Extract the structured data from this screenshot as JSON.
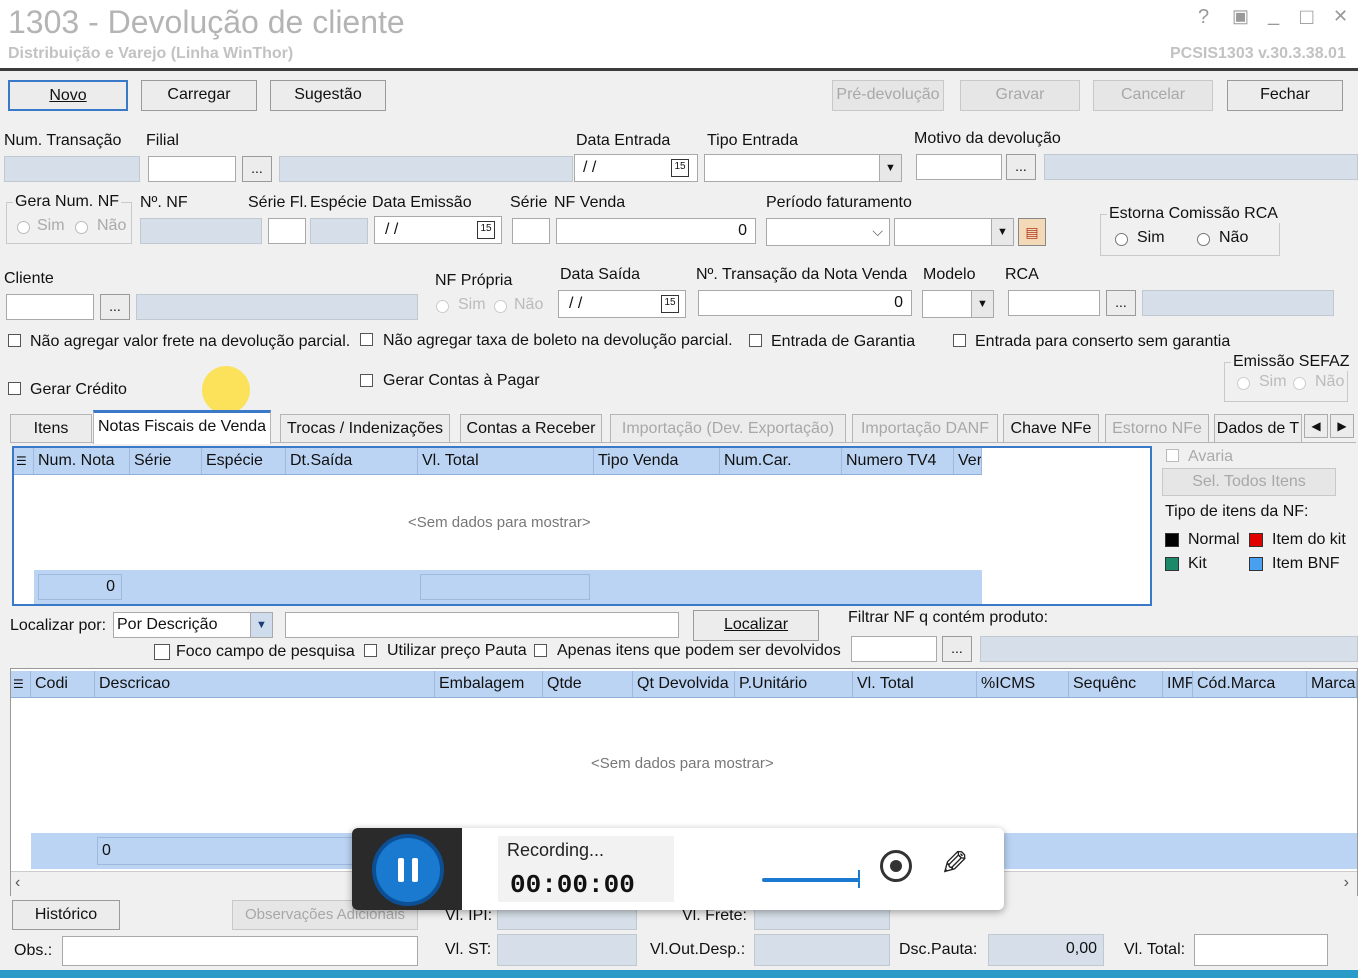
{
  "window": {
    "title": "1303 - Devolução de cliente",
    "subtitle": "Distribuição e Varejo (Linha WinThor)",
    "version": "PCSIS1303  v.30.3.38.01",
    "controls": [
      "?",
      "▣",
      "_",
      "□",
      "✕"
    ]
  },
  "toolbar": {
    "novo": "Novo",
    "carregar": "Carregar",
    "sugestao": "Sugestão",
    "pre_devolucao": "Pré-devolução",
    "gravar": "Gravar",
    "cancelar": "Cancelar",
    "fechar": "Fechar"
  },
  "form": {
    "num_transacao": "Num. Transação",
    "filial": "Filial",
    "data_entrada": "Data Entrada",
    "data_entrada_value": "/ /",
    "tipo_entrada": "Tipo Entrada",
    "motivo": "Motivo da devolução",
    "gera_num_nf": "Gera Num. NF",
    "sim": "Sim",
    "nao": "Não",
    "no_nf": "Nº. NF",
    "serie_fl": "Série Fl.",
    "especie": "Espécie",
    "data_emissao": "Data Emissão",
    "data_emissao_value": "/ /",
    "serie": "Série",
    "nf_venda": "NF Venda",
    "nf_venda_value": "0",
    "periodo_faturamento": "Período faturamento",
    "estorna_comissao": "Estorna Comissão RCA",
    "cliente": "Cliente",
    "nf_propria": "NF Própria",
    "data_saida": "Data Saída",
    "data_saida_value": "/ /",
    "no_transacao_nota_venda": "Nº. Transação da Nota Venda",
    "no_transacao_value": "0",
    "modelo": "Modelo",
    "rca": "RCA",
    "cb_frete": "Não agregar valor frete na devolução parcial.",
    "cb_boleto": "Não agregar taxa de boleto na devolução parcial.",
    "cb_garantia": "Entrada de Garantia",
    "cb_conserto": "Entrada para conserto sem garantia",
    "cb_credito": "Gerar Crédito",
    "cb_contas_pagar": "Gerar Contas à Pagar",
    "emissao_sefaz": "Emissão SEFAZ"
  },
  "tabs": [
    {
      "label": "Itens"
    },
    {
      "label": "Notas Fiscais de Venda"
    },
    {
      "label": "Trocas / Indenizações"
    },
    {
      "label": "Contas a Receber"
    },
    {
      "label": "Importação (Dev. Exportação)"
    },
    {
      "label": "Importação DANF"
    },
    {
      "label": "Chave NFe"
    },
    {
      "label": "Estorno NFe"
    },
    {
      "label": "Dados de T"
    }
  ],
  "nf_grid": {
    "columns": [
      "Num. Nota",
      "Série",
      "Espécie",
      "Dt.Saída",
      "Vl. Total",
      "Tipo Venda",
      "Num.Car.",
      "Numero TV4",
      "Ver"
    ],
    "empty": "<Sem dados para mostrar>",
    "footer_count": "0"
  },
  "side": {
    "avaria": "Avaria",
    "sel_todos": "Sel. Todos Itens",
    "tipo_itens": "Tipo de itens da NF:",
    "legend": [
      {
        "label": "Normal",
        "color": "#000000"
      },
      {
        "label": "Item do kit",
        "color": "#e00000"
      },
      {
        "label": "Kit",
        "color": "#1a8a6a"
      },
      {
        "label": "Item BNF",
        "color": "#4aa0f0"
      }
    ]
  },
  "search": {
    "localizar_por": "Localizar por:",
    "option": "Por Descrição",
    "localizar_btn": "Localizar",
    "filtrar": "Filtrar NF q contém produto:",
    "foco": "Foco campo de pesquisa",
    "preco_pauta": "Utilizar preço Pauta",
    "apenas": "Apenas itens que podem ser devolvidos"
  },
  "items_grid": {
    "columns": [
      "Codi",
      "Descricao",
      "Embalagem",
      "Qtde",
      "Qt Devolvida",
      "P.Unitário",
      "Vl. Total",
      "%ICMS",
      "Sequênc",
      "IMF",
      "Cód.Marca",
      "Marca"
    ],
    "empty": "<Sem dados para mostrar>",
    "footer_count": "0"
  },
  "bottom": {
    "historico": "Histórico",
    "observacoes": "Observações Adicionais",
    "obs": "Obs.:",
    "vl_ipi": "Vl. IPI:",
    "vl_frete": "Vl. Frete:",
    "vl_st": "Vl. ST:",
    "vl_out_desp": "Vl.Out.Desp.:",
    "dsc_pauta": "Dsc.Pauta:",
    "dsc_pauta_value": "0,00",
    "vl_total": "Vl. Total:"
  },
  "recorder": {
    "status": "Recording...",
    "time": "00:00:00"
  }
}
